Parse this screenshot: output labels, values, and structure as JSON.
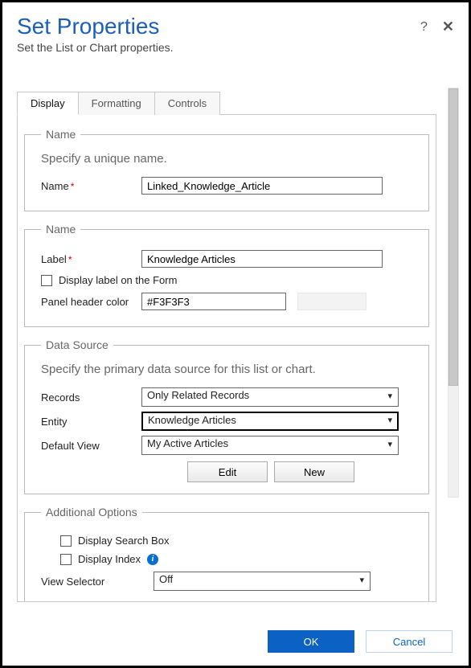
{
  "header": {
    "title": "Set Properties",
    "subtitle": "Set the List or Chart properties."
  },
  "tabs": [
    "Display",
    "Formatting",
    "Controls"
  ],
  "section_name1": {
    "legend": "Name",
    "hint": "Specify a unique name.",
    "name_label": "Name",
    "name_value": "Linked_Knowledge_Article"
  },
  "section_name2": {
    "legend": "Name",
    "label_label": "Label",
    "label_value": "Knowledge Articles",
    "display_label_cb": "Display label on the Form",
    "panel_color_label": "Panel header color",
    "panel_color_value": "#F3F3F3"
  },
  "section_ds": {
    "legend": "Data Source",
    "hint": "Specify the primary data source for this list or chart.",
    "records_label": "Records",
    "records_value": "Only Related Records",
    "entity_label": "Entity",
    "entity_value": "Knowledge Articles",
    "defaultview_label": "Default View",
    "defaultview_value": "My Active Articles",
    "edit_btn": "Edit",
    "new_btn": "New"
  },
  "section_addl": {
    "legend": "Additional Options",
    "display_search": "Display Search Box",
    "display_index": "Display Index",
    "view_selector_label": "View Selector",
    "view_selector_value": "Off"
  },
  "footer": {
    "ok": "OK",
    "cancel": "Cancel"
  }
}
